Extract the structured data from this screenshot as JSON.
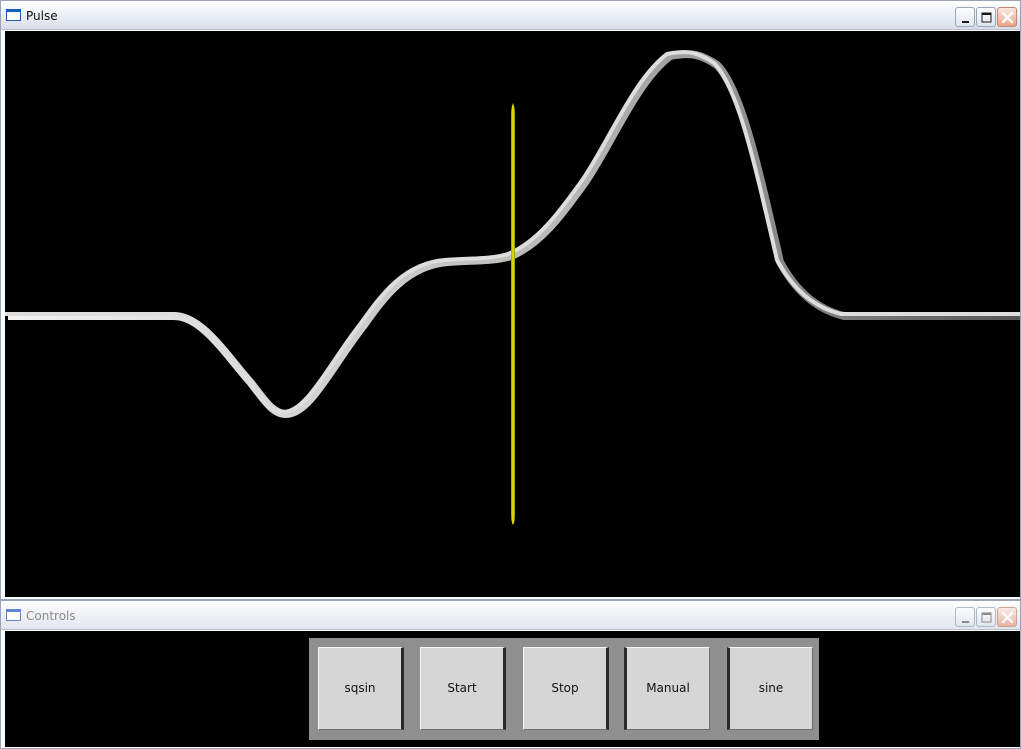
{
  "pulse_window": {
    "title": "Pulse",
    "icon": "window-icon",
    "window_controls": [
      "minimize-icon",
      "maximize-icon",
      "close-icon"
    ]
  },
  "controls_window": {
    "title": "Controls",
    "icon": "window-icon",
    "window_controls": [
      "minimize-icon",
      "maximize-icon",
      "close-icon"
    ],
    "buttons": [
      {
        "label": "sqsin"
      },
      {
        "label": "Start"
      },
      {
        "label": "Stop"
      },
      {
        "label": "Manual"
      },
      {
        "label": "sine"
      }
    ]
  },
  "colors": {
    "canvas": "#000000",
    "pulse_line": "#d7d7d7",
    "marker_line": "#d4d400",
    "button_panel": "#8f8f8f",
    "button_face": "#d6d6d6"
  }
}
